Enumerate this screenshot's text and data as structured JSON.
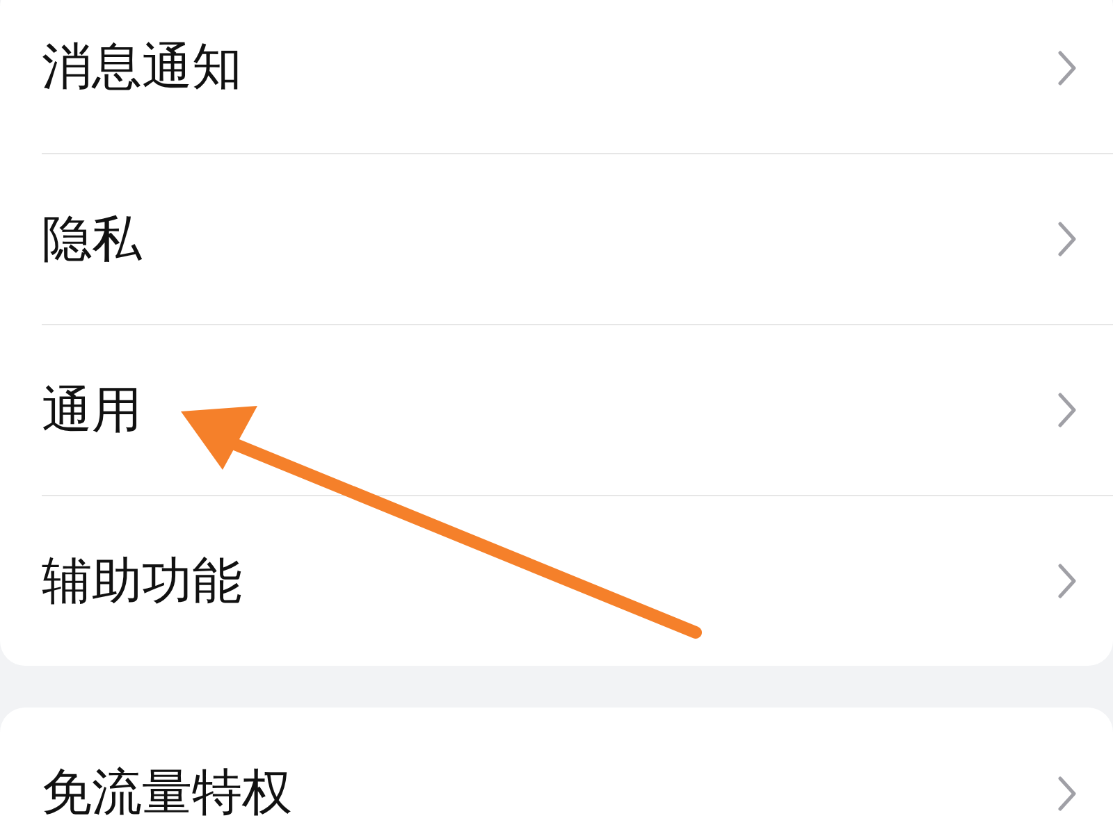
{
  "groups": [
    {
      "items": [
        {
          "label": "消息通知"
        },
        {
          "label": "隐私"
        },
        {
          "label": "通用"
        },
        {
          "label": "辅助功能"
        }
      ]
    },
    {
      "items": [
        {
          "label": "免流量特权"
        }
      ]
    }
  ]
}
